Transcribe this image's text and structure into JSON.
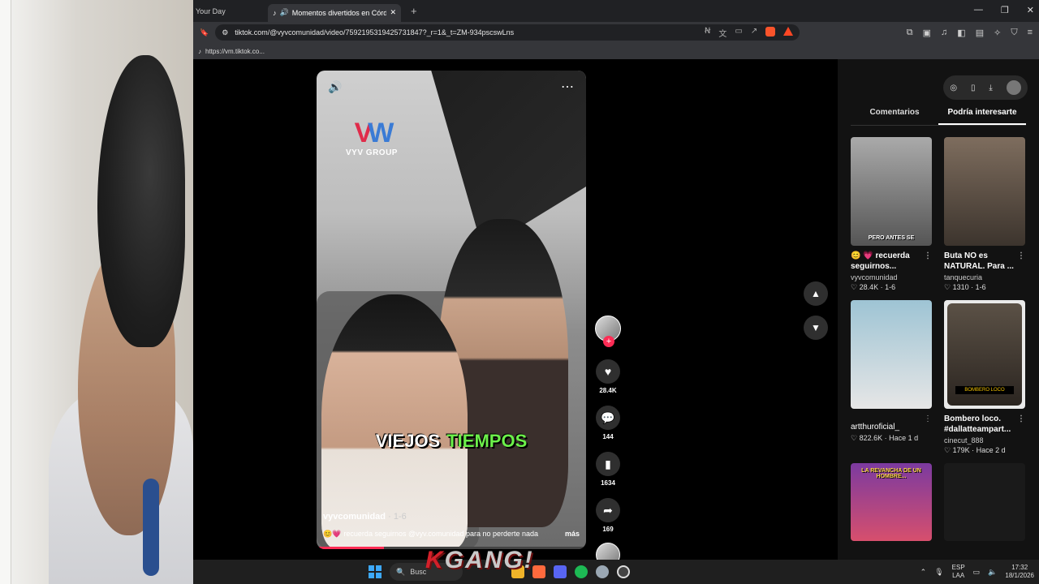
{
  "browser": {
    "prev_tab": "Your Day",
    "active_tab": "Momentos divertidos en Córdoba",
    "url": "tiktok.com/@vyvcomunidad/video/7592195319425731847?_r=1&_t=ZM-934pscswLns",
    "bookmark": "https://vm.tiktok.co..."
  },
  "video": {
    "logo_letters": [
      "V",
      "W"
    ],
    "logo_name": "VYV GROUP",
    "caption_word1": "VIEJOS",
    "caption_word2": "TIEMPOS",
    "username": "vyvcomunidad",
    "posted": "· 1-6",
    "description": "recuerda seguirnos @vyv.comunidad para no perderte nada",
    "more": "más",
    "progress": 0.25
  },
  "actions": {
    "likes": "28.4K",
    "comments": "144",
    "saves": "1634",
    "shares": "169"
  },
  "sidepanel": {
    "tab_comments": "Comentarios",
    "tab_suggested": "Podría interesarte",
    "cards": [
      {
        "overlay": "PERO ANTES SE",
        "title": "😊 💗 recuerda seguirnos...",
        "author": "vyvcomunidad",
        "stats": "♡ 28.4K · 1-6"
      },
      {
        "overlay": "",
        "title": "Buta NO es NATURAL. Para ...",
        "author": "tanquecuria",
        "stats": "♡ 1310 · 1-6"
      },
      {
        "overlay": "",
        "title": "",
        "author": "artthuroficial_",
        "stats": "♡ 822.6K · Hace 1 d"
      },
      {
        "overlay": "BOMBERO LOCO",
        "title": "Bombero loco. #dallatteampart...",
        "author": "cinecut_888",
        "stats": "♡ 179K · Hace 2 d"
      },
      {
        "overlay": "LA REVANCHA DE UN HOMBRE...",
        "title": "",
        "author": "",
        "stats": ""
      },
      {
        "overlay": "",
        "title": "",
        "author": "",
        "stats": ""
      }
    ]
  },
  "taskbar": {
    "search": "Busc",
    "watermark_k": "K",
    "watermark_rest": "GANG!",
    "lang1": "ESP",
    "lang2": "LAA",
    "time": "17:32",
    "date": "18/1/2026"
  }
}
